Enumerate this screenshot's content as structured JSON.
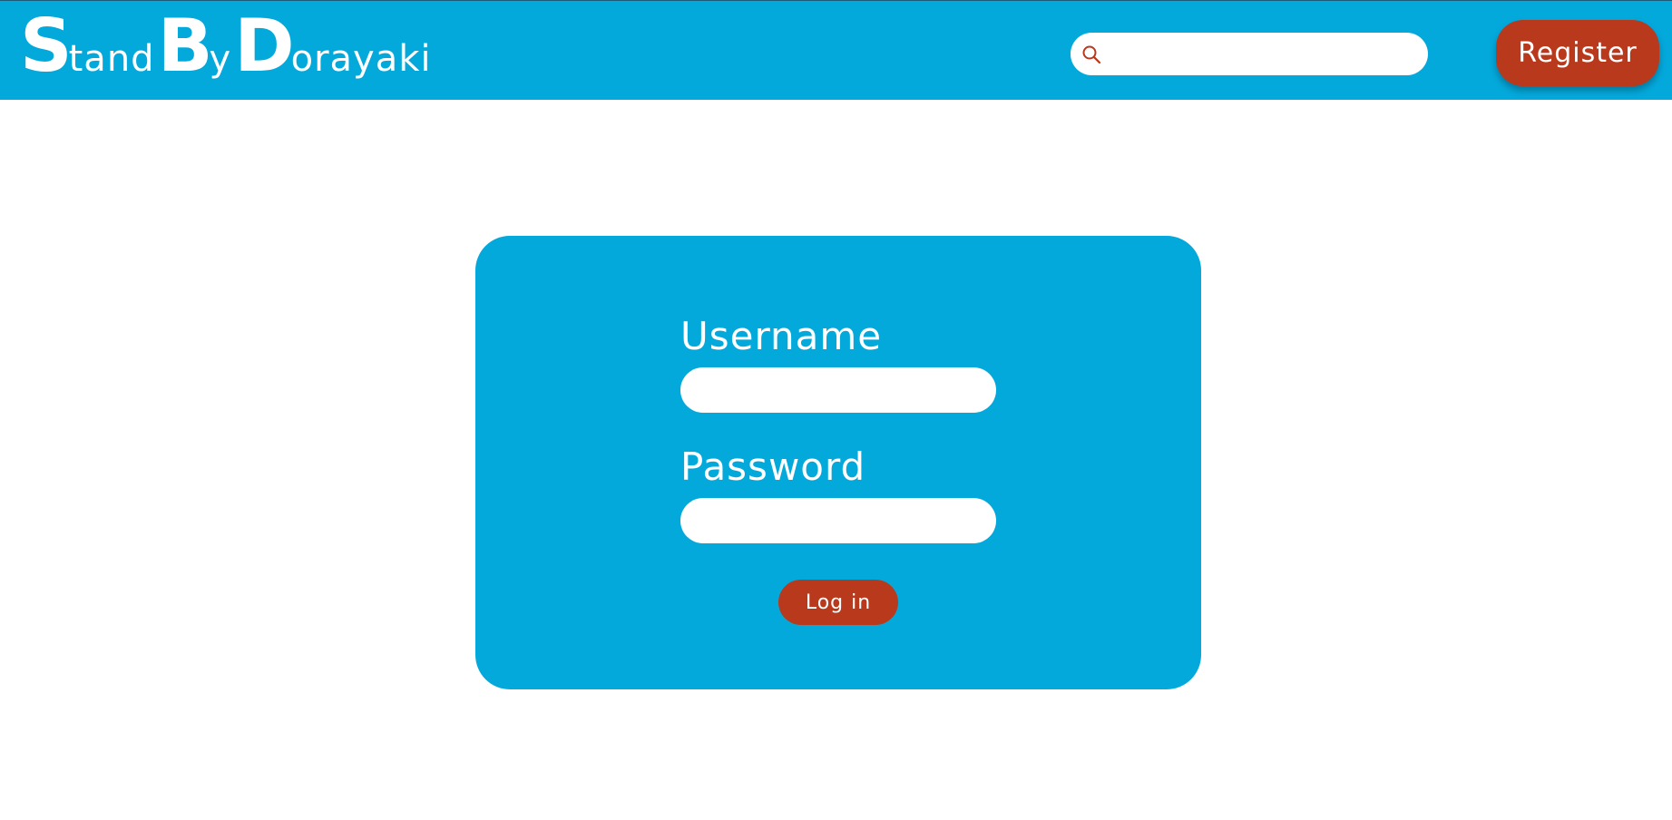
{
  "header": {
    "logo_parts": [
      "S",
      "tand",
      "B",
      "y",
      "D",
      "orayaki"
    ],
    "search": {
      "placeholder": "",
      "value": ""
    },
    "search_icon": "search-icon",
    "register_label": "Register"
  },
  "login_form": {
    "username_label": "Username",
    "username_value": "",
    "password_label": "Password",
    "password_value": "",
    "submit_label": "Log in"
  },
  "colors": {
    "primary": "#04a9dc",
    "accent": "#b9391c",
    "background": "#ffffff",
    "text_on_primary": "#ffffff"
  }
}
